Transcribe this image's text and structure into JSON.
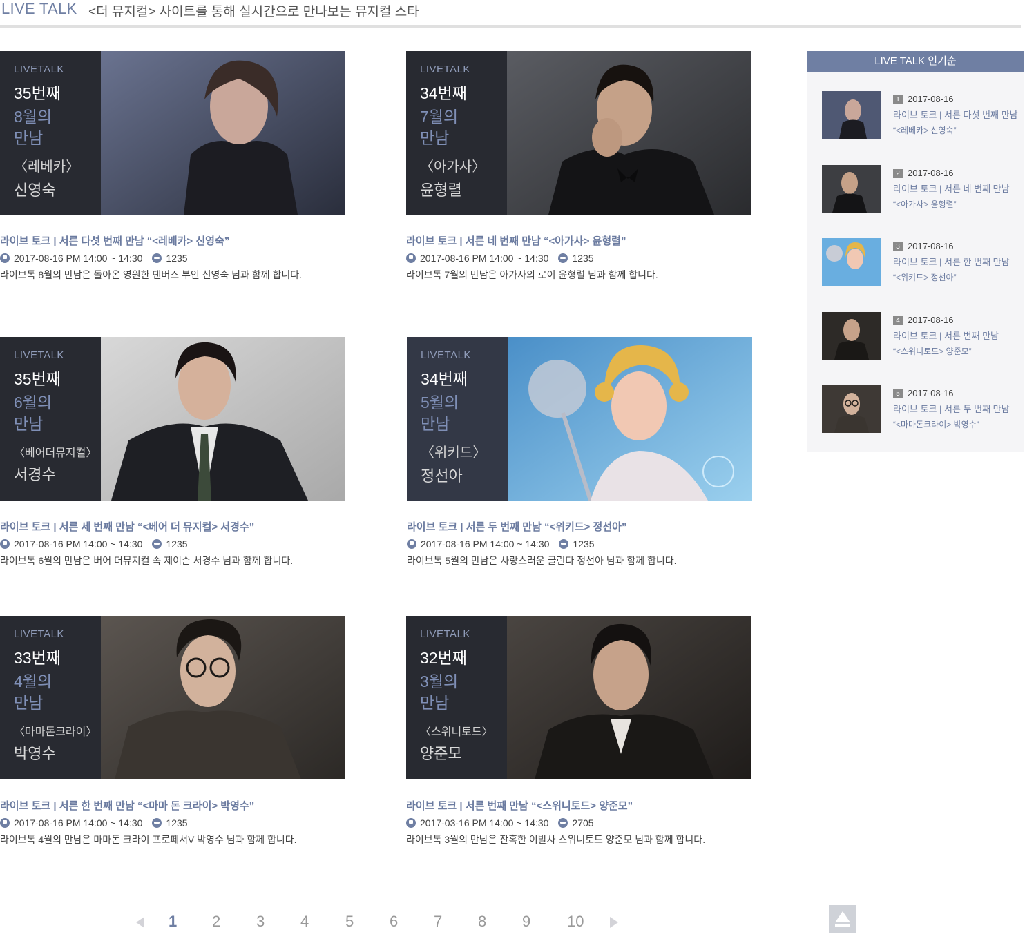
{
  "header": {
    "title": "LIVE TALK",
    "subtitle": "<더 뮤지컬> 사이트를 통해 실시간으로 만나보는 뮤지컬 스타"
  },
  "cards": [
    {
      "overlay": {
        "brand": "LIVETALK",
        "nth": "35번째",
        "month1": "8월의",
        "month2": "만남",
        "show": "〈레베카〉",
        "actor": "신영숙"
      },
      "title": "라이브 토크 | 서른 다섯 번째 만남 “<레베카> 신영숙”",
      "datetime": "2017-08-16 PM 14:00 ~ 14:30",
      "comments": "1235",
      "desc": "라이브톡 8월의 만남은 돌아온 영원한 댄버스 부인 신영숙 님과 함께 합니다."
    },
    {
      "overlay": {
        "brand": "LIVETALK",
        "nth": "34번째",
        "month1": "7월의",
        "month2": "만남",
        "show": "〈아가사〉",
        "actor": "윤형렬"
      },
      "title": "라이브 토크 | 서른 네 번째 만남 “<아가사> 윤형렬”",
      "datetime": "2017-08-16 PM 14:00 ~ 14:30",
      "comments": "1235",
      "desc": "라이브톡 7월의 만남은 아가사의 로이 윤형렬 님과 함께 합니다."
    },
    {
      "overlay": {
        "brand": "LIVETALK",
        "nth": "35번째",
        "month1": "6월의",
        "month2": "만남",
        "show": "〈베어더뮤지컬〉",
        "actor": "서경수"
      },
      "title": "라이브 토크 | 서른 세 번째 만남 “<베어 더 뮤지컬> 서경수”",
      "datetime": "2017-08-16 PM 14:00 ~ 14:30",
      "comments": "1235",
      "desc": "라이브톡 6월의 만남은 버어 더뮤지컬 속 제이슨 서경수 님과 함께 합니다."
    },
    {
      "overlay": {
        "brand": "LIVETALK",
        "nth": "34번째",
        "month1": "5월의",
        "month2": "만남",
        "show": "〈위키드〉",
        "actor": "정선아"
      },
      "title": "라이브 토크 | 서른 두 번째 만남 “<위키드> 정선아”",
      "datetime": "2017-08-16 PM 14:00 ~ 14:30",
      "comments": "1235",
      "desc": "라이브톡 5월의 만남은 사랑스러운 글린다 정선아 님과 함께 합니다."
    },
    {
      "overlay": {
        "brand": "LIVETALK",
        "nth": "33번째",
        "month1": "4월의",
        "month2": "만남",
        "show": "〈마마돈크라이〉",
        "actor": "박영수"
      },
      "title": "라이브 토크 | 서른 한 번째 만남 “<마마 돈 크라이> 박영수”",
      "datetime": "2017-08-16 PM 14:00 ~ 14:30",
      "comments": "1235",
      "desc": "라이브톡 4월의 만남은 마마돈 크라이 프로페서V 박영수 님과 함께 합니다."
    },
    {
      "overlay": {
        "brand": "LIVETALK",
        "nth": "32번째",
        "month1": "3월의",
        "month2": "만남",
        "show": "〈스위니토드〉",
        "actor": "양준모"
      },
      "title": "라이브 토크 | 서른 번째 만남 “<스위니토드> 양준모”",
      "datetime": "2017-03-16 PM 14:00 ~ 14:30",
      "comments": "2705",
      "desc": "라이브톡 3월의 만남은 잔혹한 이발사 스위니토드 양준모 님과 함께 합니다."
    }
  ],
  "sidebar": {
    "heading": "LIVE TALK 인기순",
    "items": [
      {
        "rank": "1",
        "date": "2017-08-16",
        "line1": "라이브 토크 | 서른 다섯 번째 만남",
        "line2": "“<레베카> 신영숙”"
      },
      {
        "rank": "2",
        "date": "2017-08-16",
        "line1": "라이브 토크 | 서른 네 번째 만남",
        "line2": "“<아가사> 윤형렬”"
      },
      {
        "rank": "3",
        "date": "2017-08-16",
        "line1": "라이브 토크 | 서른 한 번째 만남",
        "line2": "“<위키드> 정선아”"
      },
      {
        "rank": "4",
        "date": "2017-08-16",
        "line1": "라이브 토크 | 서른 번째 만남",
        "line2": "“<스위니토드> 양준모”"
      },
      {
        "rank": "5",
        "date": "2017-08-16",
        "line1": "라이브 토크 | 서른 두 번째 만남",
        "line2": "“<마마돈크라이> 박영수”"
      }
    ]
  },
  "pagination": {
    "pages": [
      "1",
      "2",
      "3",
      "4",
      "5",
      "6",
      "7",
      "8",
      "9",
      "10"
    ],
    "current": "1"
  },
  "colors": {
    "accent": "#6f7fa3",
    "overlay": "#282a32",
    "sidebar_bg": "#f5f5f7"
  },
  "icons": {
    "time": "clock-icon",
    "comments": "comment-icon",
    "prev": "prev-arrow-icon",
    "next": "next-arrow-icon",
    "top": "scroll-top-icon"
  }
}
